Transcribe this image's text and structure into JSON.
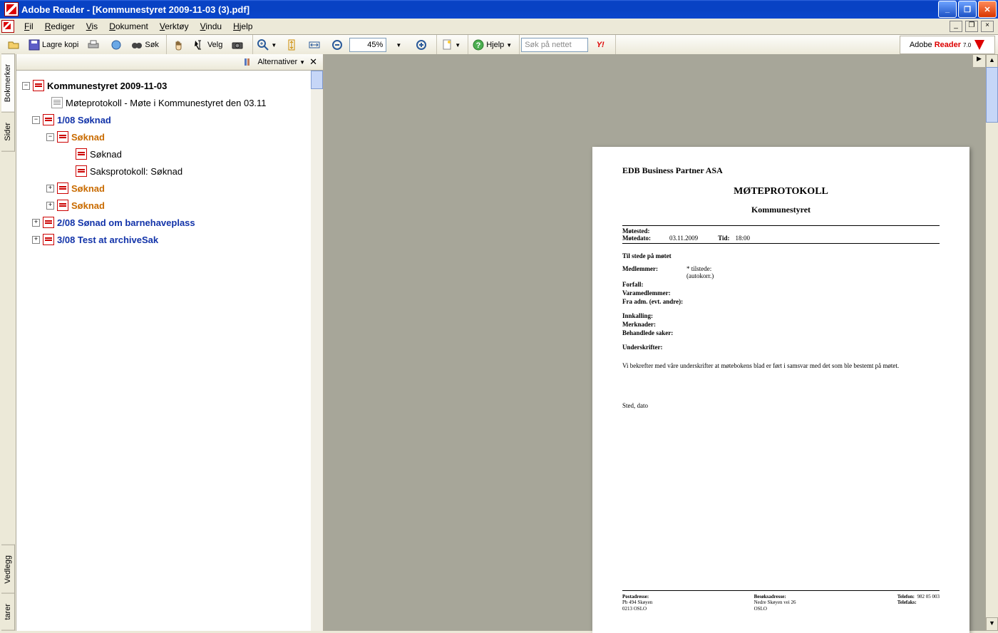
{
  "title": "Adobe Reader - [Kommunestyret 2009-11-03 (3).pdf]",
  "menu": {
    "fil": "Fil",
    "rediger": "Rediger",
    "vis": "Vis",
    "dokument": "Dokument",
    "verktoy": "Verktøy",
    "vindu": "Vindu",
    "hjelp": "Hjelp"
  },
  "toolbar": {
    "lagre_kopi": "Lagre kopi",
    "sok": "Søk",
    "velg": "Velg",
    "zoom": "45%",
    "hjelp": "Hjelp",
    "sok_nettet": "Søk på nettet",
    "brand1": "Adobe",
    "brand2": "Reader",
    "brand3": "7.0"
  },
  "sidetabs": {
    "bokmerker": "Bokmerker",
    "sider": "Sider",
    "vedlegg": "Vedlegg",
    "kommentarer": "tarer"
  },
  "panel": {
    "alternativer": "Alternativer"
  },
  "tree": {
    "root": "Kommunestyret 2009-11-03",
    "n1": "Møteprotokoll - Møte i Kommunestyret den 03.11",
    "n2": "1/08 Søknad",
    "n2a": "Søknad",
    "n2a1": "Søknad",
    "n2a2": "Saksprotokoll: Søknad",
    "n2b": "Søknad",
    "n2c": "Søknad",
    "n3": "2/08 Sønad om barnehaveplass",
    "n4": "3/08 Test at archiveSak"
  },
  "doc": {
    "org": "EDB Business Partner ASA",
    "title": "MØTEPROTOKOLL",
    "sub": "Kommunestyret",
    "motested_l": "Møtested:",
    "motedato_l": "Møtedato:",
    "motedato_v": "03.11.2009",
    "tid_l": "Tid:",
    "tid_v": "18:00",
    "tilstede": "Til stede på møtet",
    "medlemmer": "Medlemmer:",
    "tilstede_v": "* tilstede:",
    "autokorr": "(autokorr.)",
    "forfall": "Forfall:",
    "varamedlemmer": "Varamedlemmer:",
    "fraadm": "Fra adm. (evt. andre):",
    "innkalling": "Innkalling:",
    "merknader": "Merknader:",
    "behandlede": "Behandlede saker:",
    "underskrifter": "Underskrifter:",
    "bekrefter": "Vi bekrefter med våre underskrifter at møtebokens blad er ført i samsvar med det som ble bestemt på møtet.",
    "sted": "Sted, dato",
    "foot_post_h": "Postadresse:",
    "foot_post_1": "Pb 494 Skøyen",
    "foot_post_2": "0213  OSLO",
    "foot_besok_h": "Besøksadresse:",
    "foot_besok_1": "Nedre Skøyen vei 26",
    "foot_besok_2": "OSLO",
    "foot_tel_h": "Telefon:",
    "foot_tel_v": "982 05 003",
    "foot_fax_h": "Telefaks:"
  }
}
